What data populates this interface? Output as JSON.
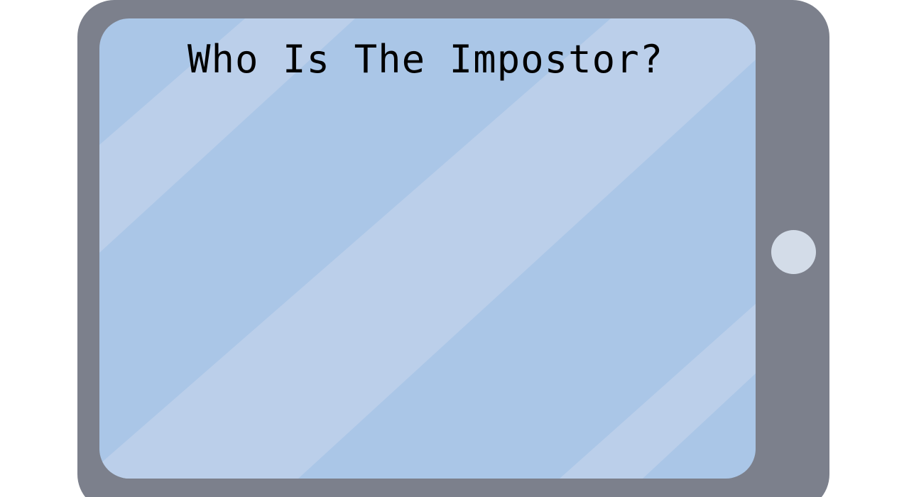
{
  "game": {
    "title": "Who Is The Impostor?"
  },
  "device": {
    "type": "tablet",
    "frame_color": "#7c808c",
    "screen_color": "#aac6e7",
    "glare_color": "#bbcfea",
    "home_button_color": "#d3dce8",
    "home_button_icon": "home-button-icon"
  }
}
